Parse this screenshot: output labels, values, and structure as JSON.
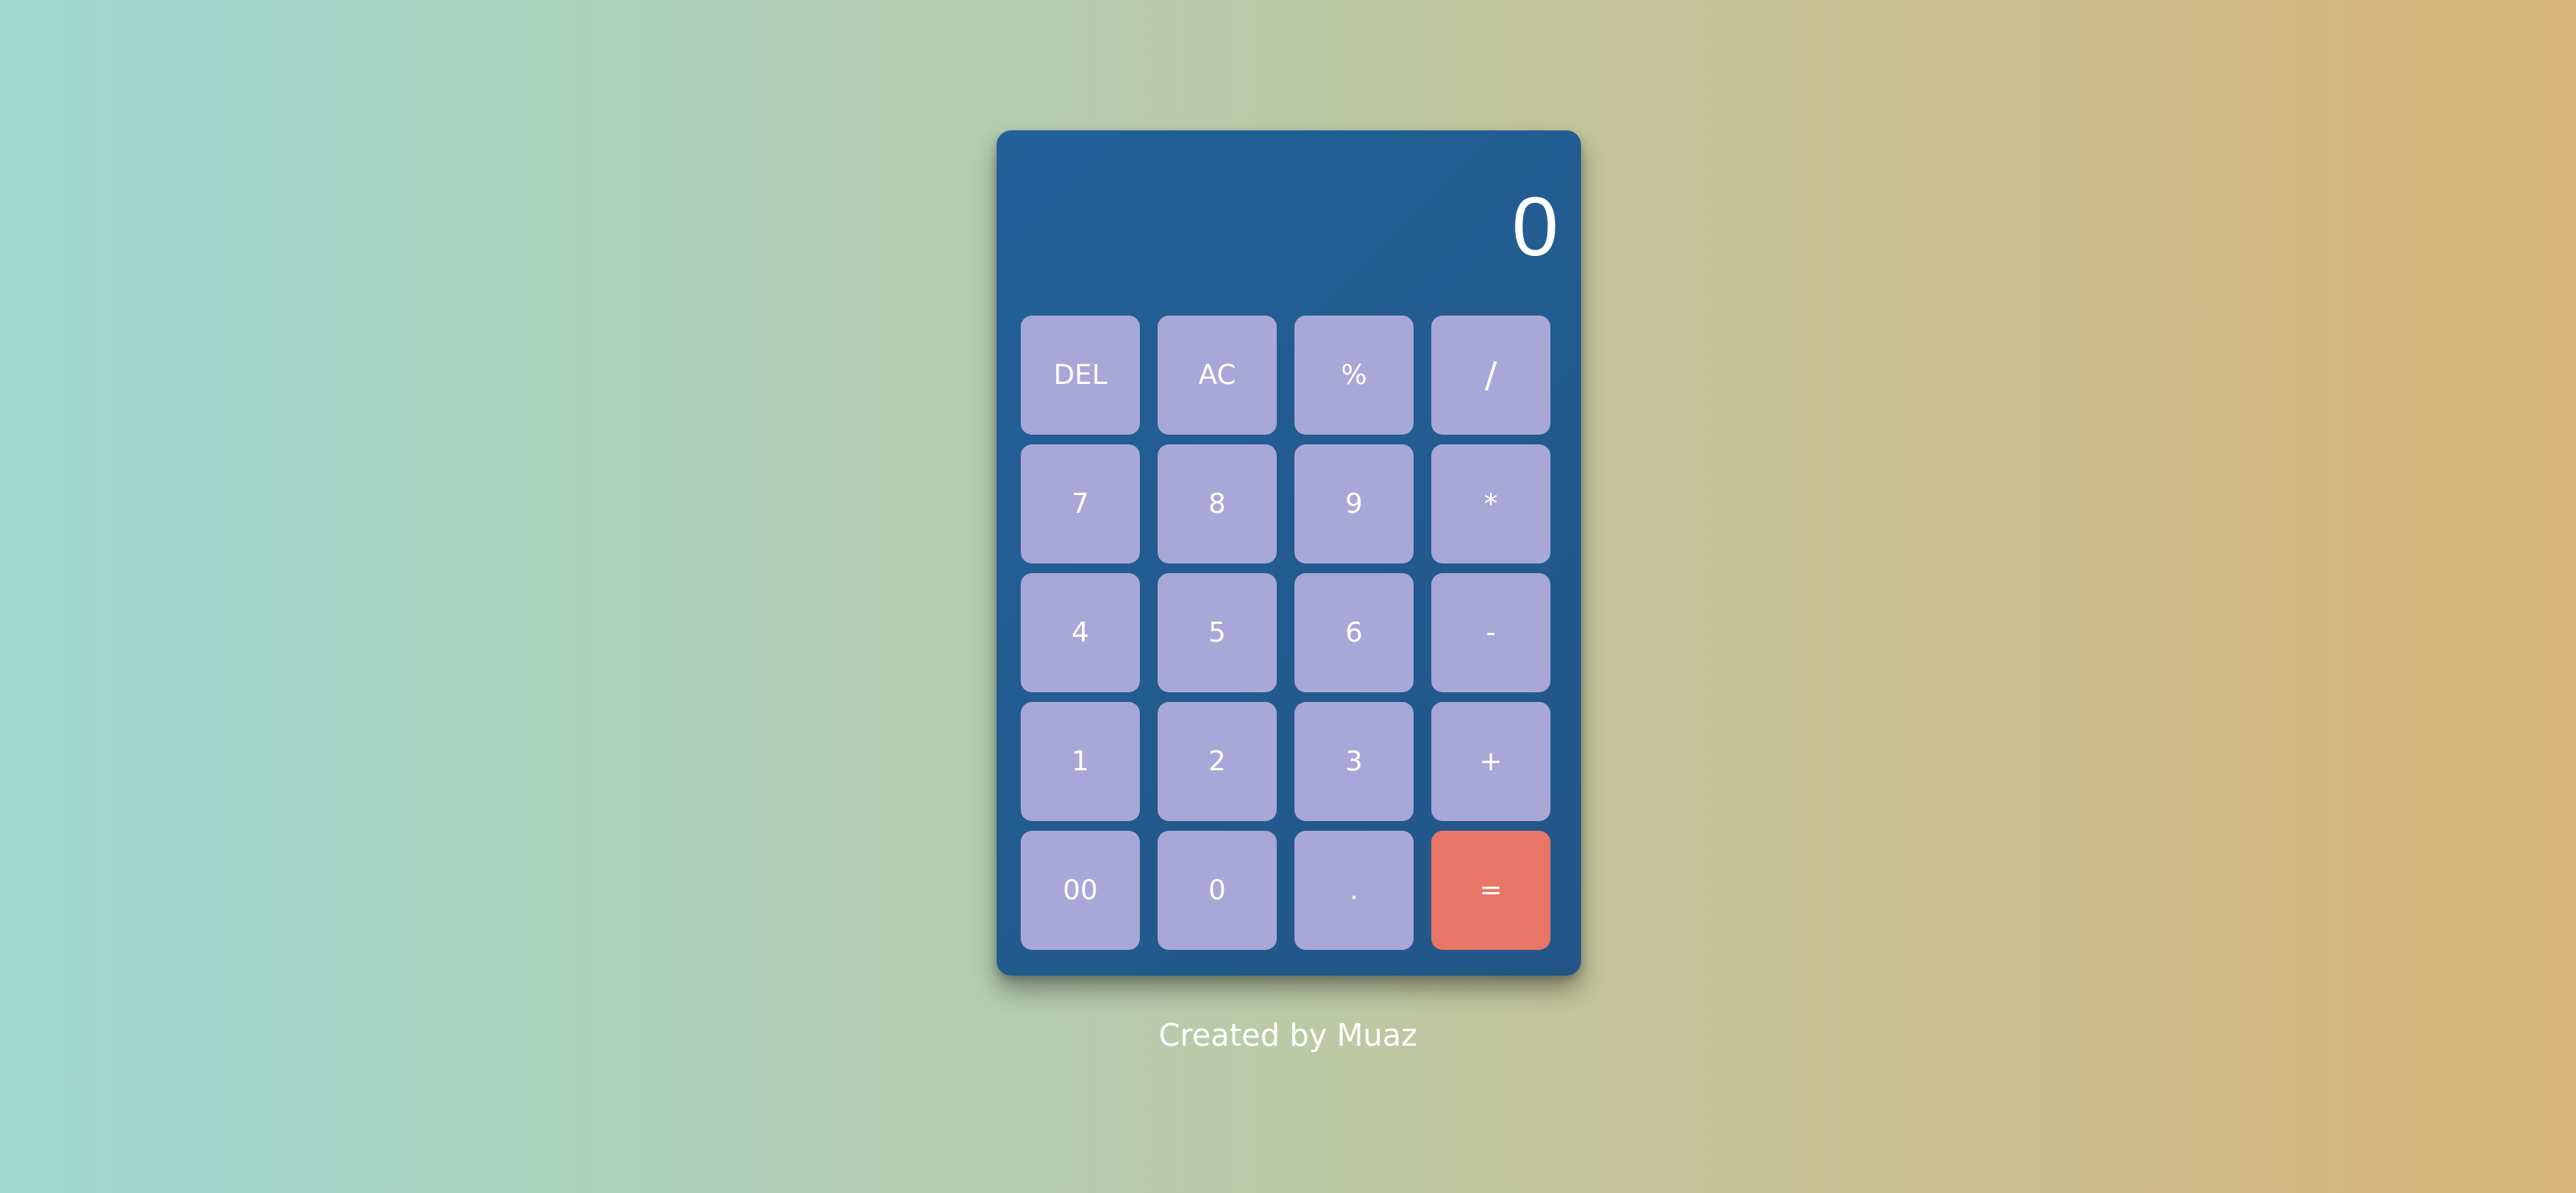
{
  "calculator": {
    "display_value": "0",
    "keys": [
      {
        "label": "DEL",
        "name": "delete-button"
      },
      {
        "label": "AC",
        "name": "all-clear-button"
      },
      {
        "label": "%",
        "name": "percent-button"
      },
      {
        "label": "/",
        "name": "divide-button"
      },
      {
        "label": "7",
        "name": "digit-7-button"
      },
      {
        "label": "8",
        "name": "digit-8-button"
      },
      {
        "label": "9",
        "name": "digit-9-button"
      },
      {
        "label": "*",
        "name": "multiply-button"
      },
      {
        "label": "4",
        "name": "digit-4-button"
      },
      {
        "label": "5",
        "name": "digit-5-button"
      },
      {
        "label": "6",
        "name": "digit-6-button"
      },
      {
        "label": "-",
        "name": "subtract-button"
      },
      {
        "label": "1",
        "name": "digit-1-button"
      },
      {
        "label": "2",
        "name": "digit-2-button"
      },
      {
        "label": "3",
        "name": "digit-3-button"
      },
      {
        "label": "+",
        "name": "add-button"
      },
      {
        "label": "00",
        "name": "double-zero-button"
      },
      {
        "label": "0",
        "name": "digit-0-button"
      },
      {
        "label": ".",
        "name": "decimal-point-button"
      },
      {
        "label": "=",
        "name": "equals-button"
      }
    ]
  },
  "footer": {
    "credit": "Created by Muaz"
  },
  "colors": {
    "background_left": "#9dd8d1",
    "background_right": "#d8b57b",
    "calculator_body": "#216199",
    "key": "#a8a7d8",
    "equals_key": "#e87566",
    "text": "#ffffff"
  }
}
